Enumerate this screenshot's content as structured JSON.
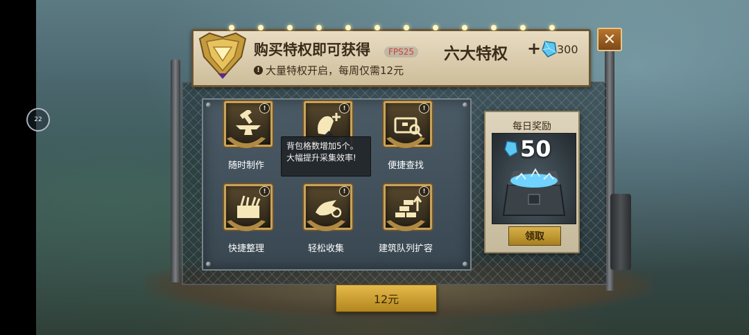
{
  "header": {
    "title": "购买特权即可获得",
    "fps_label": "FPS25",
    "subtitle": "大量特权开启，每周仅需12元",
    "privileges_label": "六大特权",
    "plus": "+",
    "gem_amount": "300",
    "close_icon": "close-icon"
  },
  "side_button": {
    "label": "22"
  },
  "features": [
    {
      "label": "随时制作",
      "icon": "anvil-hammer-icon"
    },
    {
      "label": "",
      "icon": "backpack-plus-icon"
    },
    {
      "label": "便捷查找",
      "icon": "chest-search-icon"
    },
    {
      "label": "快捷整理",
      "icon": "tool-box-icon"
    },
    {
      "label": "轻松收集",
      "icon": "hand-gather-icon"
    },
    {
      "label": "建筑队列扩容",
      "icon": "bricks-upgrade-icon"
    }
  ],
  "tooltip": {
    "line1": "背包格数增加5个。",
    "line2": "大幅提升采集效率!"
  },
  "daily_reward": {
    "title": "每日奖励",
    "amount": "50",
    "claim_label": "领取"
  },
  "purchase": {
    "price_label": "12元"
  },
  "colors": {
    "gold": "#c9a35a",
    "button_gold": "#d9b04a",
    "sign_paper": "#e8dcc2",
    "panel_steel": "#4b5b66"
  }
}
